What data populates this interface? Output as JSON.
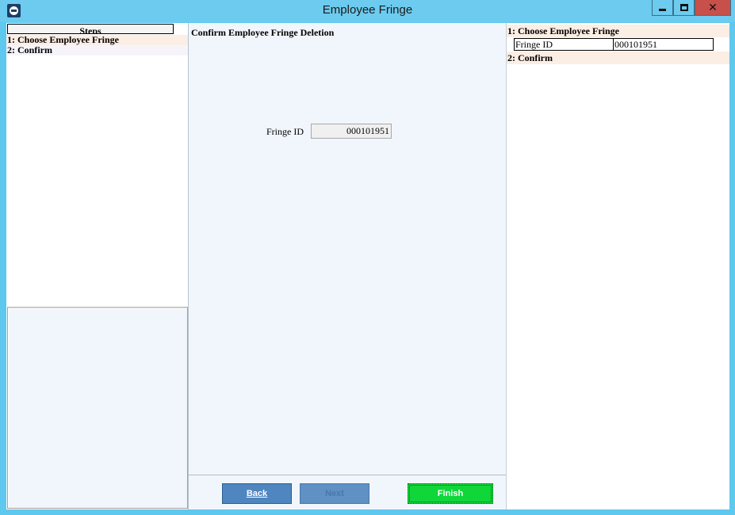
{
  "window": {
    "title": "Employee Fringe"
  },
  "steps": {
    "header": "Steps",
    "items": [
      {
        "label": "1: Choose Employee Fringe"
      },
      {
        "label": "2: Confirm"
      }
    ]
  },
  "main": {
    "title": "Confirm Employee Fringe Deletion",
    "fringe_id_label": "Fringe ID",
    "fringe_id_value": "000101951"
  },
  "buttons": {
    "back": "Back",
    "next": "Next",
    "finish": "Finish"
  },
  "summary": {
    "sections": [
      {
        "title": "1: Choose Employee Fringe"
      },
      {
        "title": "2: Confirm"
      }
    ],
    "fields": [
      {
        "label": "Fringe ID",
        "value": "000101951"
      }
    ]
  },
  "colors": {
    "title_bar": "#6ccbef",
    "close_button": "#c7504a",
    "finish_button": "#10d63a",
    "nav_button": "#4f86bf",
    "step_highlight": "#fbeee4"
  }
}
